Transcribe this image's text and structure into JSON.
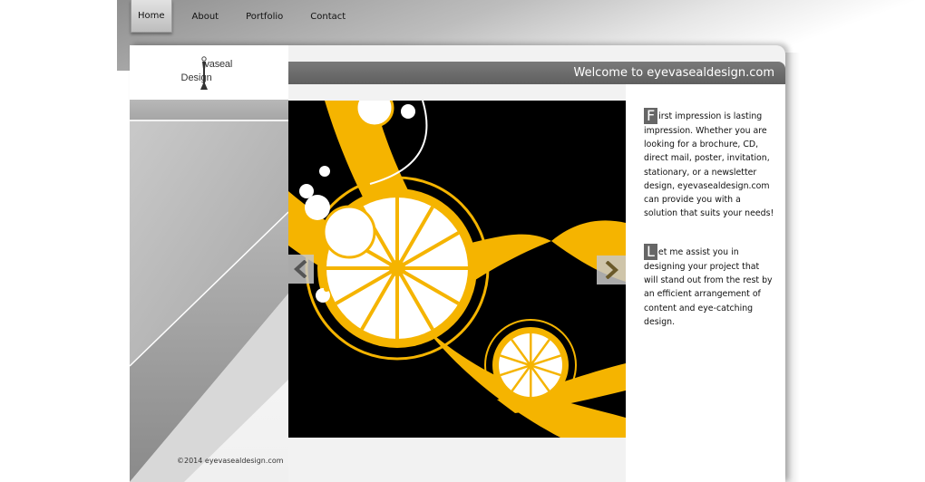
{
  "nav": {
    "items": [
      {
        "label": "Home",
        "active": true
      },
      {
        "label": "About",
        "active": false
      },
      {
        "label": "Portfolio",
        "active": false
      },
      {
        "label": "Contact",
        "active": false
      }
    ]
  },
  "logo": {
    "top_text": "vaseal",
    "bottom_text": "Design"
  },
  "header": {
    "title": "Welcome to eyevasealdesign.com"
  },
  "slider": {
    "prev_icon": "chevron-left-icon",
    "next_icon": "chevron-right-icon"
  },
  "content": {
    "para1": {
      "dropcap": "F",
      "text": "irst impression is lasting impression. Whether you are looking for a brochure, CD, direct mail, poster, invitation, stationary, or a newsletter design, eyevasealdesign.com can provide you with a solution that suits your needs!"
    },
    "para2": {
      "dropcap": "L",
      "text": "et me assist you in designing your project that will stand out from the rest by an efficient arrangement of content and eye-catching design."
    }
  },
  "footer": {
    "copyright": "©2014 eyevasealdesign.com"
  },
  "colors": {
    "accent": "#f5b400",
    "header": "#6b6b6b",
    "panel": "#f2f2f2"
  }
}
